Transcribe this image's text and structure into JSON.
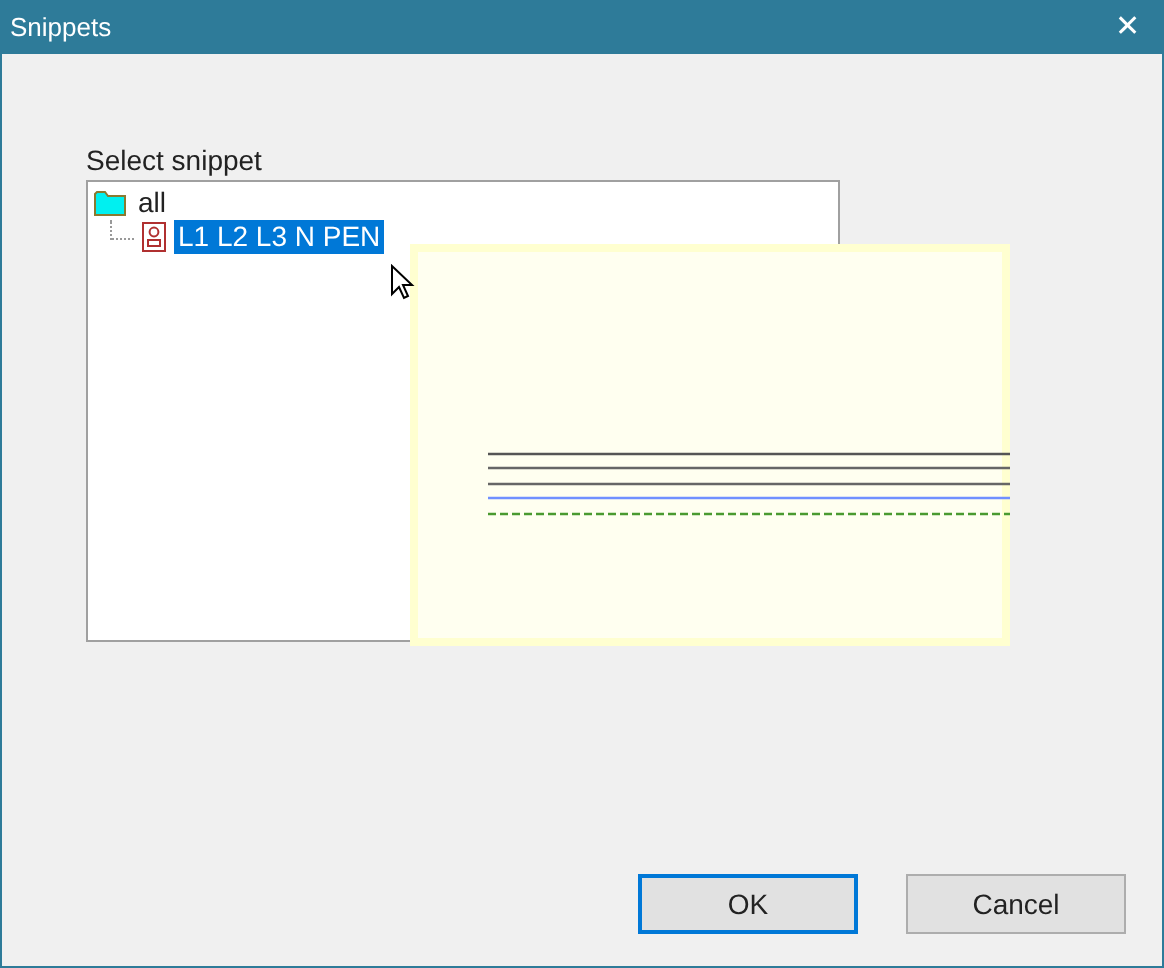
{
  "window": {
    "title": "Snippets",
    "close": "✕"
  },
  "label": "Select snippet",
  "tree": [
    {
      "label": "all",
      "kind": "folder",
      "selected": false,
      "children": [
        {
          "label": "L1 L2 L3 N PEN",
          "kind": "snippet",
          "selected": true
        }
      ]
    }
  ],
  "buttons": [
    {
      "label": "OK",
      "default": true
    },
    {
      "label": "Cancel",
      "default": false
    }
  ]
}
